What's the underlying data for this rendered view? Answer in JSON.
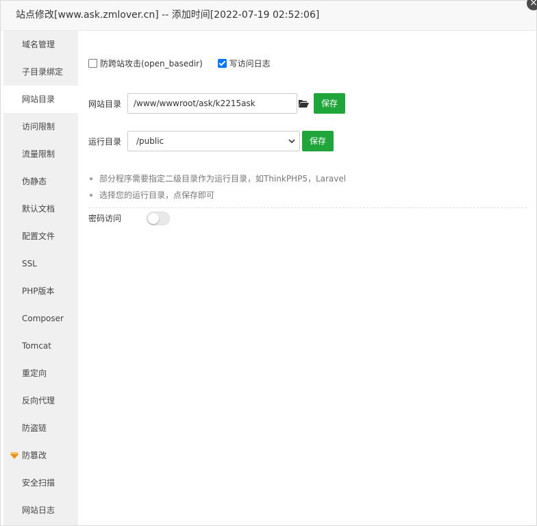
{
  "dialog": {
    "title": "站点修改[www.ask.zmlover.cn] -- 添加时间[2022-07-19 02:52:06]",
    "close_glyph": "×"
  },
  "sidebar": {
    "items": [
      {
        "label": "域名管理"
      },
      {
        "label": "子目录绑定"
      },
      {
        "label": "网站目录",
        "active": true
      },
      {
        "label": "访问限制"
      },
      {
        "label": "流量限制"
      },
      {
        "label": "伪静态"
      },
      {
        "label": "默认文档"
      },
      {
        "label": "配置文件"
      },
      {
        "label": "SSL"
      },
      {
        "label": "PHP版本"
      },
      {
        "label": "Composer"
      },
      {
        "label": "Tomcat"
      },
      {
        "label": "重定向"
      },
      {
        "label": "反向代理"
      },
      {
        "label": "防盗链"
      },
      {
        "label": "防篡改",
        "icon": "gem-icon"
      },
      {
        "label": "安全扫描"
      },
      {
        "label": "网站日志"
      }
    ]
  },
  "main": {
    "anti_cross_site": {
      "label": "防跨站攻击(open_basedir)",
      "checked": false
    },
    "write_access_log": {
      "label": "写访问日志",
      "checked": true
    },
    "site_dir": {
      "label": "网站目录",
      "value": "/www/wwwroot/ask/k2215ask",
      "save_label": "保存"
    },
    "run_dir": {
      "label": "运行目录",
      "value": "/public",
      "save_label": "保存"
    },
    "tips": [
      "部分程序需要指定二级目录作为运行目录，如ThinkPHP5，Laravel",
      "选择您的运行目录，点保存即可"
    ],
    "password_access": {
      "label": "密码访问",
      "enabled": false
    }
  },
  "colors": {
    "accent_green": "#20a53a",
    "checkbox_blue": "#0075ff",
    "gem_orange": "#f5a623"
  }
}
